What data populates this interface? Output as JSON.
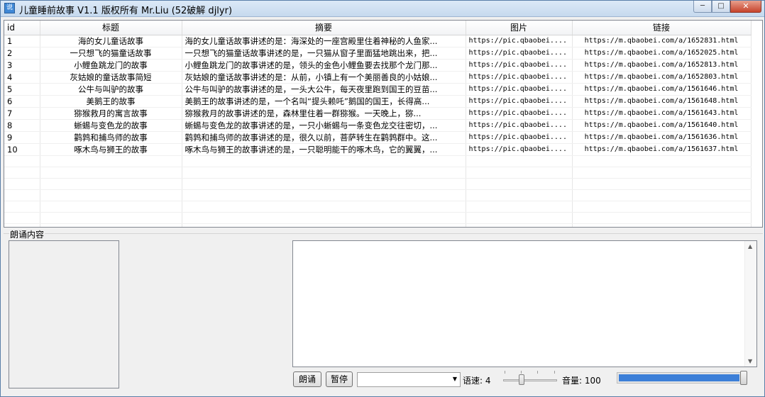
{
  "window": {
    "title": "儿童睡前故事 V1.1    版权所有 Mr.Liu (52破解 djlyr)",
    "icon_glyph": "说",
    "controls": {
      "minimize": "─",
      "maximize": "□",
      "close": "✕"
    }
  },
  "table": {
    "columns": [
      "id",
      "标题",
      "摘要",
      "图片",
      "链接"
    ],
    "rows": [
      {
        "id": "1",
        "title": "海的女儿童话故事",
        "summary": "海的女儿童话故事讲述的是：海深处的一座宫殿里住着神秘的人鱼家...",
        "image": "https://pic.qbaobei....",
        "link": "https://m.qbaobei.com/a/1652831.html"
      },
      {
        "id": "2",
        "title": "一只想飞的猫童话故事",
        "summary": "一只想飞的猫童话故事讲述的是，一只猫从窗子里面猛地跳出来，把...",
        "image": "https://pic.qbaobei....",
        "link": "https://m.qbaobei.com/a/1652025.html"
      },
      {
        "id": "3",
        "title": "小鲤鱼跳龙门的故事",
        "summary": "小鲤鱼跳龙门的故事讲述的是，领头的金色小鲤鱼要去找那个龙门那...",
        "image": "https://pic.qbaobei....",
        "link": "https://m.qbaobei.com/a/1652813.html"
      },
      {
        "id": "4",
        "title": "灰姑娘的童话故事简短",
        "summary": "灰姑娘的童话故事讲述的是：从前，小镇上有一个美丽善良的小姑娘...",
        "image": "https://pic.qbaobei....",
        "link": "https://m.qbaobei.com/a/1652803.html"
      },
      {
        "id": "5",
        "title": "公牛与叫驴的故事",
        "summary": "公牛与叫驴的故事讲述的是，一头大公牛，每天夜里跑到国王的豆苗...",
        "image": "https://pic.qbaobei....",
        "link": "https://m.qbaobei.com/a/1561646.html"
      },
      {
        "id": "6",
        "title": "美鹅王的故事",
        "summary": "美鹅王的故事讲述的是，一个名叫“提头赖吒”鹅国的国王，长得高...",
        "image": "https://pic.qbaobei....",
        "link": "https://m.qbaobei.com/a/1561648.html"
      },
      {
        "id": "7",
        "title": "猕猴救月的寓言故事",
        "summary": "猕猴救月的故事讲述的是，森林里住着一群猕猴。一天晚上，猕...",
        "image": "https://pic.qbaobei....",
        "link": "https://m.qbaobei.com/a/1561643.html"
      },
      {
        "id": "8",
        "title": "蜥蜴与变色龙的故事",
        "summary": "蜥蜴与变色龙的故事讲述的是，一只小蜥蜴与一条变色龙交往密切，...",
        "image": "https://pic.qbaobei....",
        "link": "https://m.qbaobei.com/a/1561640.html"
      },
      {
        "id": "9",
        "title": "鹳鹑和捕鸟师的故事",
        "summary": "鹳鹑和捕鸟师的故事讲述的是，很久以前，菩萨转生在鹳鹑群中。这...",
        "image": "https://pic.qbaobei....",
        "link": "https://m.qbaobei.com/a/1561636.html"
      },
      {
        "id": "10",
        "title": "啄木鸟与狮王的故事",
        "summary": "啄木鸟与狮王的故事讲述的是，一只聪明能干的啄木鸟，它的翼翼，...",
        "image": "https://pic.qbaobei....",
        "link": "https://m.qbaobei.com/a/1561637.html"
      }
    ]
  },
  "reading": {
    "section_label": "朗诵内容",
    "text_content": "",
    "read_button": "朗诵",
    "pause_button": "暂停",
    "voice_select_value": "",
    "speed_label": "语速: 4",
    "speed_value": 4,
    "volume_label": "音量: 100",
    "volume_value": 100,
    "accent_color": "#3c7fd8"
  }
}
